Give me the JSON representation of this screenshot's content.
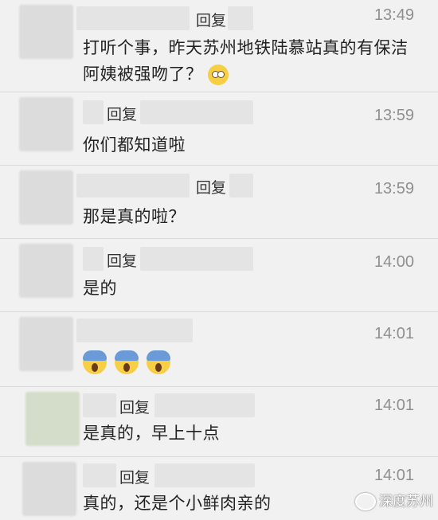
{
  "comments": [
    {
      "reply": "回复",
      "time": "13:49",
      "text": "打听个事，昨天苏州地铁陆慕站真的有保洁阿姨被强吻了？",
      "emoji_after": "flushed-face-emoji"
    },
    {
      "reply": "回复",
      "time": "13:59",
      "text": "你们都知道啦"
    },
    {
      "reply": "回复",
      "time": "13:59",
      "text": "那是真的啦？"
    },
    {
      "reply": "回复",
      "time": "14:00",
      "text": "是的"
    },
    {
      "time": "14:01",
      "emojis": [
        "face-screaming-in-fear-emoji",
        "face-screaming-in-fear-emoji",
        "face-screaming-in-fear-emoji"
      ]
    },
    {
      "reply": "回复",
      "time": "14:01",
      "text": "是真的，早上十点"
    },
    {
      "reply": "回复",
      "time": "14:01",
      "text": "真的，还是个小鲜肉亲的"
    }
  ],
  "watermark": {
    "text": "深度苏州",
    "icon": "wechat-official-account-icon"
  }
}
